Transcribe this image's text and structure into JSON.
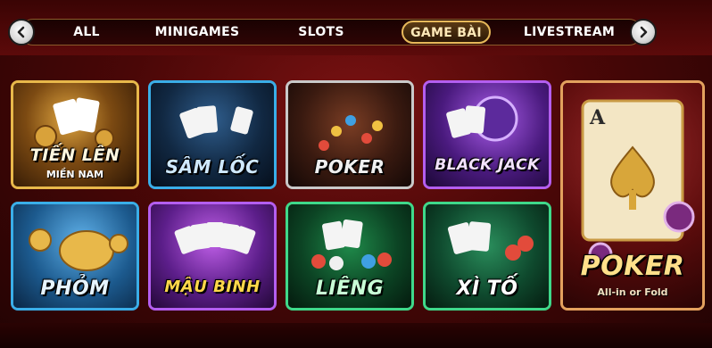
{
  "nav": {
    "prev_icon": "chevron-left-icon",
    "next_icon": "chevron-right-icon",
    "tabs": [
      {
        "label": "ALL"
      },
      {
        "label": "MINIGAMES"
      },
      {
        "label": "SLOTS"
      },
      {
        "label": "GAME BÀI",
        "active": true
      },
      {
        "label": "LIVESTREAM"
      }
    ]
  },
  "games": [
    {
      "title": "TIẾN LÊN",
      "subtitle": "MIỀN NAM"
    },
    {
      "title": "SÂM LỐC"
    },
    {
      "title": "POKER"
    },
    {
      "title": "BLACK JACK"
    },
    {
      "title": "PHỎM"
    },
    {
      "title": "MẬU BINH"
    },
    {
      "title": "LIÊNG"
    },
    {
      "title": "XÌ TỐ"
    }
  ],
  "featured": {
    "title": "POKER",
    "subtitle": "All-in or Fold"
  },
  "colors": {
    "accent_gold": "#e7b95a",
    "background": "#4a0707"
  }
}
